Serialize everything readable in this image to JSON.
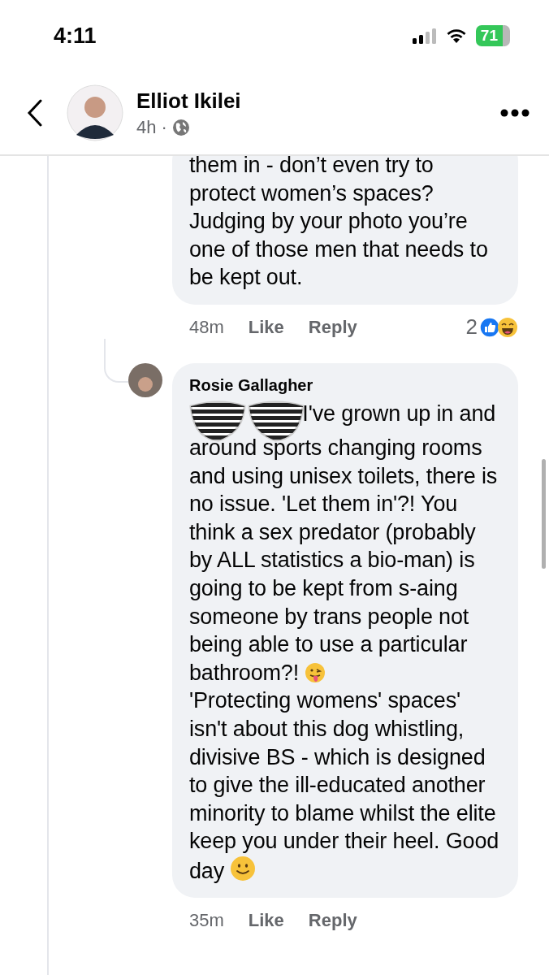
{
  "status_bar": {
    "time": "4:11",
    "battery": "71"
  },
  "header": {
    "name": "Elliot Ikilei",
    "time": "4h",
    "separator": "·"
  },
  "comments": [
    {
      "paragraphs": [
        {
          "text": "them in - don’t even try to protect women’s spaces? Judging by your photo you’re one of those men that needs to be kept out."
        }
      ],
      "time": "48m",
      "like": "Like",
      "reply": "Reply",
      "reaction_count": "2",
      "reactions": [
        {
          "kind": "like"
        },
        {
          "kind": "haha"
        }
      ]
    },
    {
      "author": "Rosie Gallagher",
      "sticker": true,
      "paragraphs": [
        {
          "text": "I've grown up in and around sports changing rooms and using unisex toilets, there is no issue. 'Let them in'?! You think a sex predator (probably by ALL statistics a bio-man) is going to be kept from s-aing someone by trans people not being able to use a particular bathroom?!",
          "end_icon": {
            "kind": "tongue"
          }
        },
        {
          "text": "'Protecting womens' spaces' isn't about this dog whistling, divisive BS - which is designed to give the ill-educated another minority to blame whilst the elite keep you under their heel. Good day",
          "end_icon": {
            "kind": "smile"
          }
        }
      ],
      "time": "35m",
      "like": "Like",
      "reply": "Reply"
    }
  ]
}
